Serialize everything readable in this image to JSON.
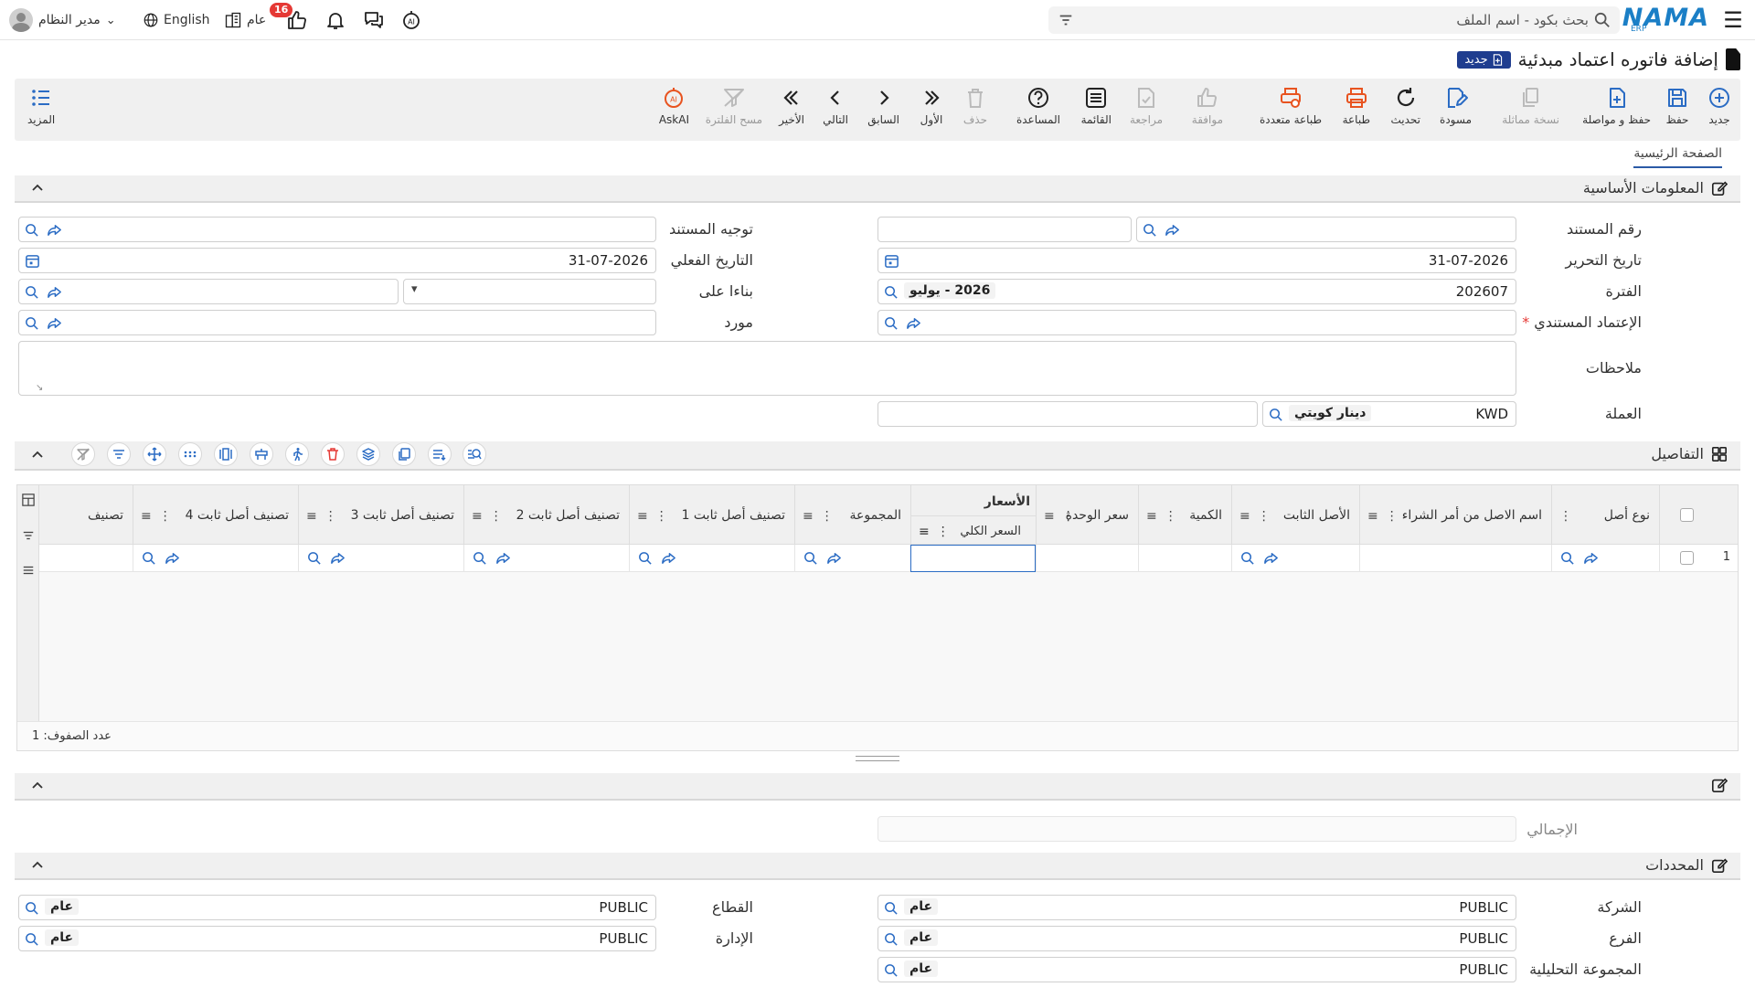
{
  "topbar": {
    "logo": "NAMA",
    "logo_sub": "ERP",
    "search_placeholder": "بحث بكود - اسم الملف",
    "user_name": "مدير النظام",
    "language": "English",
    "public_label": "عام",
    "notifications_count": "16"
  },
  "page": {
    "title": "إضافة فاتوره اعتماد مبدئية",
    "new_badge": "جديد"
  },
  "toolbar": {
    "new": "جديد",
    "save": "حفظ",
    "save_continue": "حفظ و مواصلة",
    "duplicate": "نسخة مماثلة",
    "draft": "مسودة",
    "refresh": "تحديث",
    "print": "طباعة",
    "multi_print": "طباعة متعددة",
    "approve": "موافقة",
    "review": "مراجعة",
    "list": "القائمة",
    "help": "المساعدة",
    "delete": "حذف",
    "first": "الأول",
    "previous": "السابق",
    "next": "التالي",
    "last": "الأخير",
    "clear_filter": "مسح الفلترة",
    "askai": "AskAI",
    "more": "المزيد"
  },
  "tabs": {
    "main": "الصفحة الرئيسية"
  },
  "basic_info": {
    "title": "المعلومات الأساسية",
    "doc_number_label": "رقم المستند",
    "doc_direction_label": "توجيه المستند",
    "edit_date_label": "تاريخ التحرير",
    "edit_date": "31-07-2026",
    "actual_date_label": "التاريخ الفعلي",
    "actual_date": "31-07-2026",
    "period_label": "الفترة",
    "period_code": "202607",
    "period_name": "2026 - يوليو",
    "based_on_label": "بناءا على",
    "doc_credit_label": "الإعتماد المستندي",
    "required_mark": "*",
    "supplier_label": "مورد",
    "notes_label": "ملاحظات",
    "currency_label": "العملة",
    "currency_code": "KWD",
    "currency_name": "دينار كويتي"
  },
  "details": {
    "title": "التفاصيل",
    "columns": {
      "asset_type": "نوع أصل",
      "asset_name_po": "اسم الاصل من أمر الشراء",
      "fixed_asset": "الأصل الثابت",
      "quantity": "الكمية",
      "unit_price": "سعر الوحدة",
      "prices_group": "الأسعار",
      "total_price": "السعر الكلي",
      "group": "المجموعة",
      "class1": "تصنيف أصل ثابت 1",
      "class2": "تصنيف أصل ثابت 2",
      "class3": "تصنيف أصل ثابت 3",
      "class4": "تصنيف أصل ثابت 4",
      "class5": "تصنيف"
    },
    "rows": [
      {
        "num": "1"
      }
    ],
    "row_count": "عدد الصفوف: 1"
  },
  "totals": {
    "total_label": "الإجمالي"
  },
  "dimensions": {
    "title": "المحددات",
    "company_label": "الشركة",
    "company_code": "PUBLIC",
    "company_name": "عام",
    "sector_label": "القطاع",
    "sector_code": "PUBLIC",
    "sector_name": "عام",
    "branch_label": "الفرع",
    "branch_code": "PUBLIC",
    "branch_name": "عام",
    "department_label": "الإدارة",
    "department_code": "PUBLIC",
    "department_name": "عام",
    "analytic_label": "المجموعة التحليلية",
    "analytic_code": "PUBLIC",
    "analytic_name": "عام"
  },
  "colors": {
    "brand": "#1b7fc6",
    "badge": "#e53935",
    "print_orange": "#e8531f",
    "primary_blue": "#2b6cc4",
    "new_badge_bg": "#1f3d8f"
  }
}
